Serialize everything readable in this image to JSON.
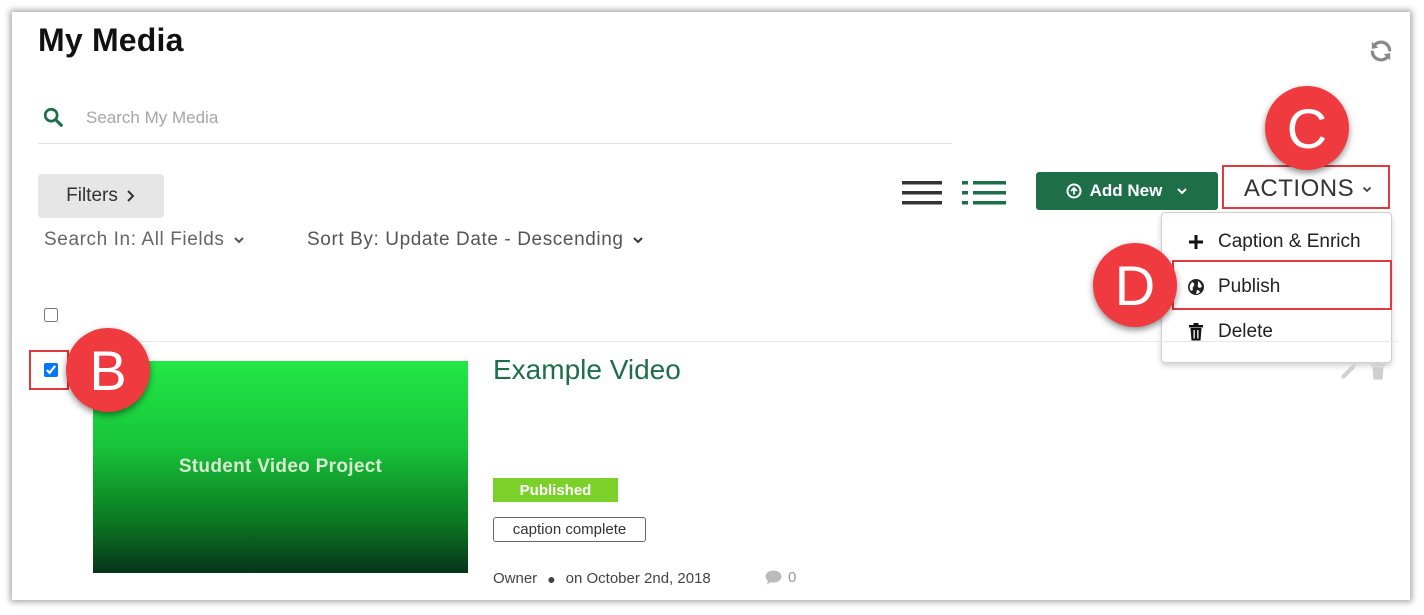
{
  "page": {
    "title": "My Media"
  },
  "search": {
    "placeholder": "Search My Media"
  },
  "toolbar": {
    "filters_label": "Filters",
    "add_new_label": "Add New",
    "actions_label": "ACTIONS",
    "search_in_label": "Search In: All Fields",
    "sort_by_label": "Sort By: Update Date - Descending"
  },
  "actions_menu": {
    "items": [
      {
        "label": "Caption & Enrich",
        "icon": "plus-icon"
      },
      {
        "label": "Publish",
        "icon": "globe-icon"
      },
      {
        "label": "Delete",
        "icon": "trash-icon"
      }
    ]
  },
  "annotations": {
    "b": "B",
    "c": "C",
    "d": "D",
    "color": "#ef3b3f"
  },
  "media": [
    {
      "title": "Example Video",
      "thumbnail_text": "Student Video Project",
      "status": "Published",
      "tag": "caption complete",
      "owner": "Owner",
      "date": "on October 2nd, 2018",
      "comments": "0",
      "checked": true
    }
  ],
  "colors": {
    "brand": "#1f6e4a",
    "published": "#7bd02a",
    "highlight": "#e03a3e"
  }
}
